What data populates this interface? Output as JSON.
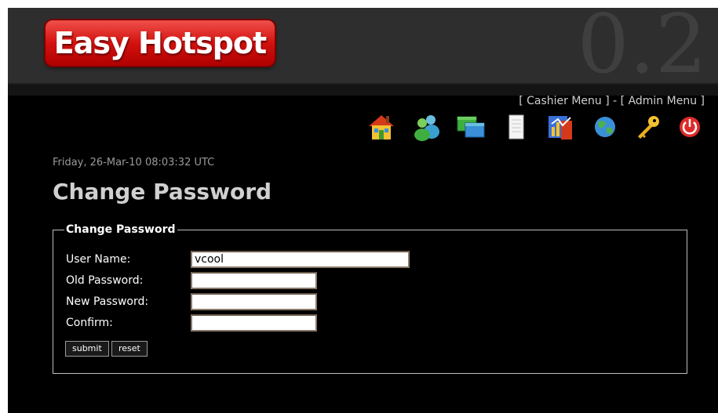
{
  "header": {
    "logo_text": "Easy Hotspot",
    "version": "0.2"
  },
  "topnav": {
    "open": "[ ",
    "cashier": "Cashier Menu",
    "mid": " ] - [ ",
    "admin": "Admin Menu",
    "close": " ]"
  },
  "toolbar_icons": [
    "home-icon",
    "users-icon",
    "windows-icon",
    "document-icon",
    "reports-icon",
    "globe-icon",
    "key-icon",
    "power-icon"
  ],
  "datetime": "Friday, 26-Mar-10 08:03:32 UTC",
  "page_title": "Change Password",
  "form": {
    "legend": "Change Password",
    "username_label": "User Name:",
    "username_value": "vcool",
    "old_password_label": "Old Password:",
    "old_password_value": "",
    "new_password_label": "New Password:",
    "new_password_value": "",
    "confirm_label": "Confirm:",
    "confirm_value": "",
    "submit_label": "submit",
    "reset_label": "reset"
  }
}
